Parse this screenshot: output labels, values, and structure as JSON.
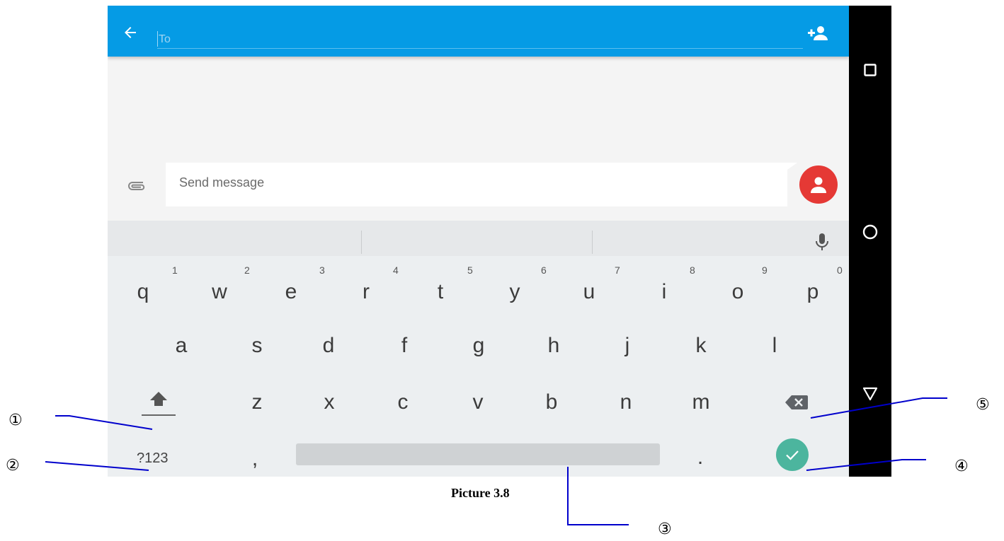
{
  "app_bar": {
    "to_placeholder": "To",
    "back_icon": "arrow-left-icon",
    "add_contact_icon": "person-add-icon",
    "color": "#059be5"
  },
  "compose": {
    "attach_icon": "paperclip-icon",
    "message_placeholder": "Send message",
    "contact_icon": "person-icon",
    "contact_button_color": "#e53935"
  },
  "keyboard": {
    "suggestion_bar_icon": "microphone-icon",
    "row1": [
      {
        "key": "q",
        "hint": "1"
      },
      {
        "key": "w",
        "hint": "2"
      },
      {
        "key": "e",
        "hint": "3"
      },
      {
        "key": "r",
        "hint": "4"
      },
      {
        "key": "t",
        "hint": "5"
      },
      {
        "key": "y",
        "hint": "6"
      },
      {
        "key": "u",
        "hint": "7"
      },
      {
        "key": "i",
        "hint": "8"
      },
      {
        "key": "o",
        "hint": "9"
      },
      {
        "key": "p",
        "hint": "0"
      }
    ],
    "row2": [
      "a",
      "s",
      "d",
      "f",
      "g",
      "h",
      "j",
      "k",
      "l"
    ],
    "row3": [
      "z",
      "x",
      "c",
      "v",
      "b",
      "n",
      "m"
    ],
    "shift_icon": "shift-arrow-icon",
    "backspace_icon": "backspace-icon",
    "symbols_label": "?123",
    "comma": ",",
    "period": ".",
    "enter_icon": "checkmark-icon",
    "enter_color": "#4cb59e"
  },
  "nav_bar": {
    "recents_icon": "square-icon",
    "home_icon": "circle-icon",
    "back_icon": "triangle-down-icon"
  },
  "annotations": {
    "callouts": [
      "①",
      "②",
      "③",
      "④",
      "⑤"
    ],
    "caption": "Picture 3.8",
    "line_color": "#0000cc"
  }
}
